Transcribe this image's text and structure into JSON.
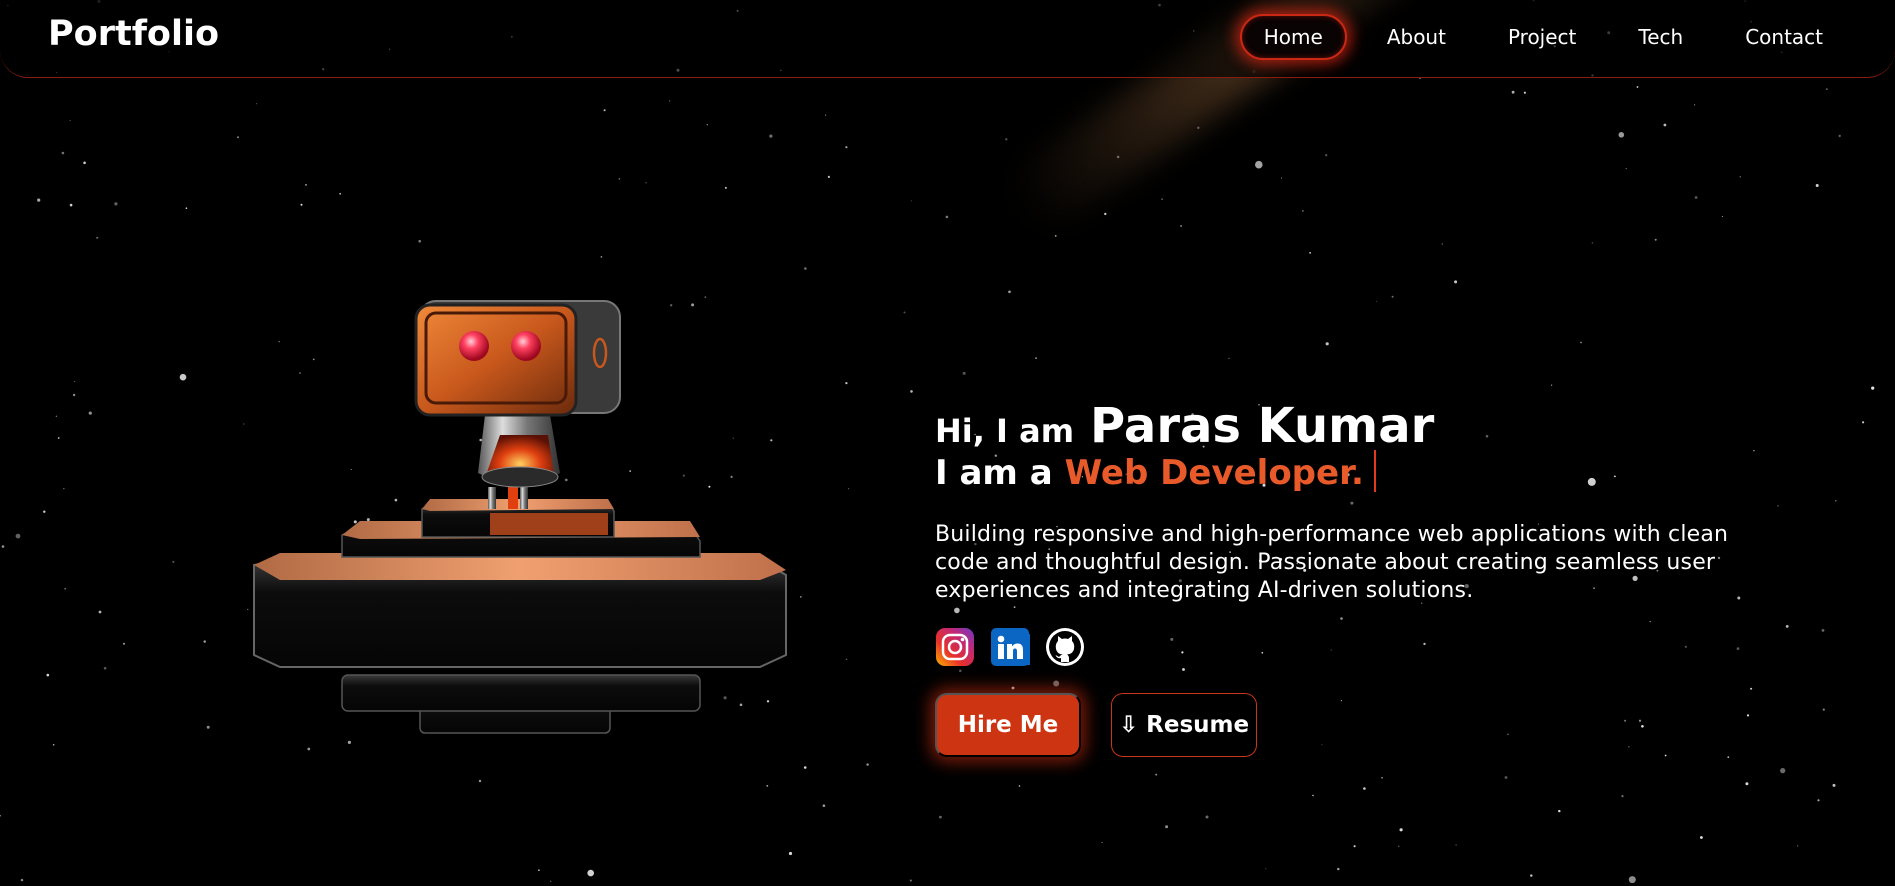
{
  "header": {
    "logo": "Portfolio",
    "nav": [
      {
        "label": "Home",
        "active": true
      },
      {
        "label": "About",
        "active": false
      },
      {
        "label": "Project",
        "active": false
      },
      {
        "label": "Tech",
        "active": false
      },
      {
        "label": "Contact",
        "active": false
      }
    ]
  },
  "hero": {
    "greeting_prefix": "Hi, I am",
    "name": "Paras Kumar",
    "role_prefix": "I am a",
    "role_highlight": "Web Developer.",
    "description": "Building responsive and high-performance web applications with clean code and thoughtful design. Passionate about creating seamless user experiences and integrating AI-driven solutions.",
    "socials": [
      {
        "icon": "instagram-icon"
      },
      {
        "icon": "linkedin-icon"
      },
      {
        "icon": "github-icon"
      }
    ],
    "buttons": {
      "hire_label": "Hire Me",
      "resume_label": "⇩ Resume"
    }
  },
  "colors": {
    "accent": "#e85a2a",
    "button": "#cc3412",
    "border": "#8a1c10",
    "background": "#000000"
  }
}
